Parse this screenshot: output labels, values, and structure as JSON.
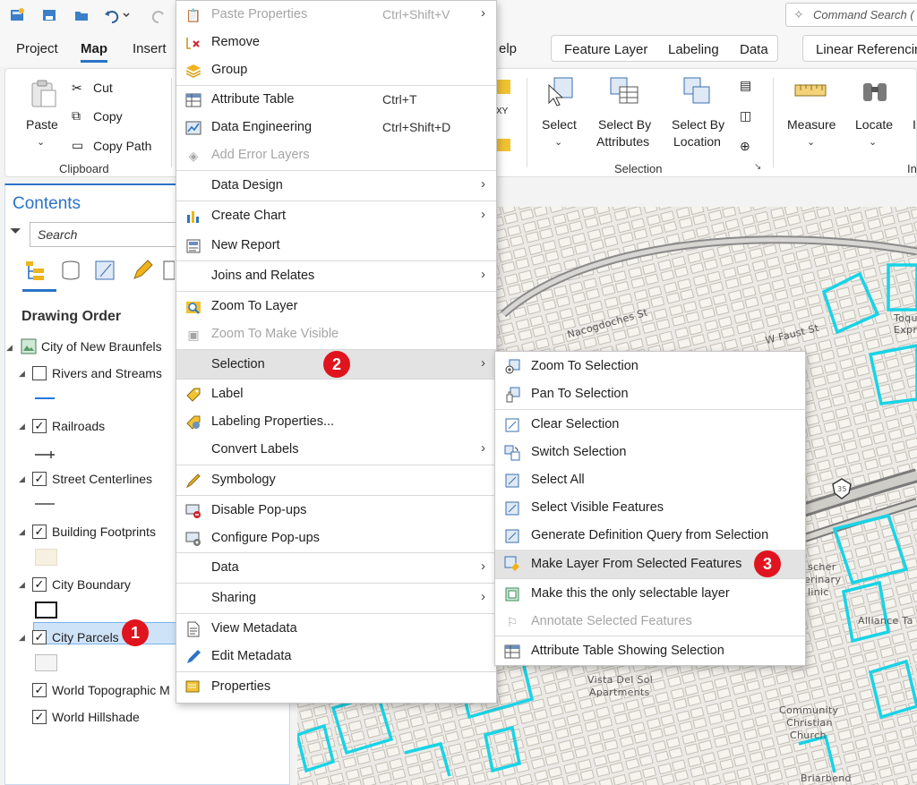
{
  "quick_access": {
    "command_search_placeholder": "Command Search ("
  },
  "ribbon_tabs": {
    "project": "Project",
    "map": "Map",
    "insert": "Insert",
    "help_fragment": "elp",
    "feature_layer": "Feature Layer",
    "labeling": "Labeling",
    "data": "Data",
    "linear_referencing": "Linear Referencin"
  },
  "ribbon": {
    "paste": "Paste",
    "cut": "Cut",
    "copy": "Copy",
    "copy_path": "Copy Path",
    "clipboard_group": "Clipboard",
    "select": "Select",
    "select_by_attributes_1": "Select By",
    "select_by_attributes_2": "Attributes",
    "select_by_location_1": "Select By",
    "select_by_location_2": "Location",
    "selection_group": "Selection",
    "measure": "Measure",
    "locate": "Locate",
    "inquiry_fragment": "In",
    "xy_fragment": "XY"
  },
  "contents": {
    "title": "Contents",
    "search_placeholder": "Search",
    "drawing_order": "Drawing Order",
    "layers": [
      {
        "name": "City of New Braunfels"
      },
      {
        "name": "Rivers and Streams",
        "checked": false
      },
      {
        "name": "Railroads",
        "checked": true
      },
      {
        "name": "Street Centerlines",
        "checked": true
      },
      {
        "name": "Building Footprints",
        "checked": true
      },
      {
        "name": "City Boundary",
        "checked": true
      },
      {
        "name": "City Parcels",
        "checked": true
      },
      {
        "name": "World Topographic M",
        "checked": true
      },
      {
        "name": "World Hillshade",
        "checked": true
      }
    ]
  },
  "context_menu": {
    "items": [
      {
        "label": "Paste Properties",
        "shortcut": "Ctrl+Shift+V",
        "disabled": true,
        "submenu": true
      },
      {
        "label": "Remove"
      },
      {
        "label": "Group"
      },
      {
        "label": "Attribute Table",
        "shortcut": "Ctrl+T"
      },
      {
        "label": "Data Engineering",
        "shortcut": "Ctrl+Shift+D"
      },
      {
        "label": "Add Error Layers",
        "disabled": true
      },
      {
        "label": "Data Design",
        "submenu": true
      },
      {
        "label": "Create Chart",
        "submenu": true
      },
      {
        "label": "New Report"
      },
      {
        "label": "Joins and Relates",
        "submenu": true
      },
      {
        "label": "Zoom To Layer"
      },
      {
        "label": "Zoom To Make Visible",
        "disabled": true
      },
      {
        "label": "Selection",
        "submenu": true,
        "highlight": true
      },
      {
        "label": "Label"
      },
      {
        "label": "Labeling Properties..."
      },
      {
        "label": "Convert Labels",
        "submenu": true
      },
      {
        "label": "Symbology"
      },
      {
        "label": "Disable Pop-ups"
      },
      {
        "label": "Configure Pop-ups"
      },
      {
        "label": "Data",
        "submenu": true
      },
      {
        "label": "Sharing",
        "submenu": true
      },
      {
        "label": "View Metadata"
      },
      {
        "label": "Edit Metadata"
      },
      {
        "label": "Properties"
      }
    ]
  },
  "selection_submenu": {
    "items": [
      {
        "label": "Zoom To Selection"
      },
      {
        "label": "Pan To Selection"
      },
      {
        "label": "Clear Selection"
      },
      {
        "label": "Switch Selection"
      },
      {
        "label": "Select All"
      },
      {
        "label": "Select Visible Features"
      },
      {
        "label": "Generate Definition Query from Selection"
      },
      {
        "label": "Make Layer From Selected Features",
        "highlight": true
      },
      {
        "label": "Make this the only selectable layer"
      },
      {
        "label": "Annotate Selected Features",
        "disabled": true
      },
      {
        "label": "Attribute Table Showing Selection"
      }
    ]
  },
  "callouts": [
    "1",
    "2",
    "3"
  ],
  "map_labels": {
    "street_1": "Nacogdoches St",
    "street_2": "W Faust St",
    "place_1": "Vista Del Sol",
    "place_1b": "Apartments",
    "place_2a": "Community",
    "place_2b": "Christian",
    "place_2c": "Church",
    "place_3": "Alliance Ta",
    "place_4a": "scher",
    "place_4b": "erinary",
    "place_4c": "linic",
    "place_5": "Briarbend",
    "place_6a": "Toqu",
    "place_6b": "Expr",
    "highway_shield": "35"
  },
  "colors": {
    "accent": "#2b73c6",
    "callout": "#e0141e",
    "parcel_outline": "#19d3e6"
  }
}
